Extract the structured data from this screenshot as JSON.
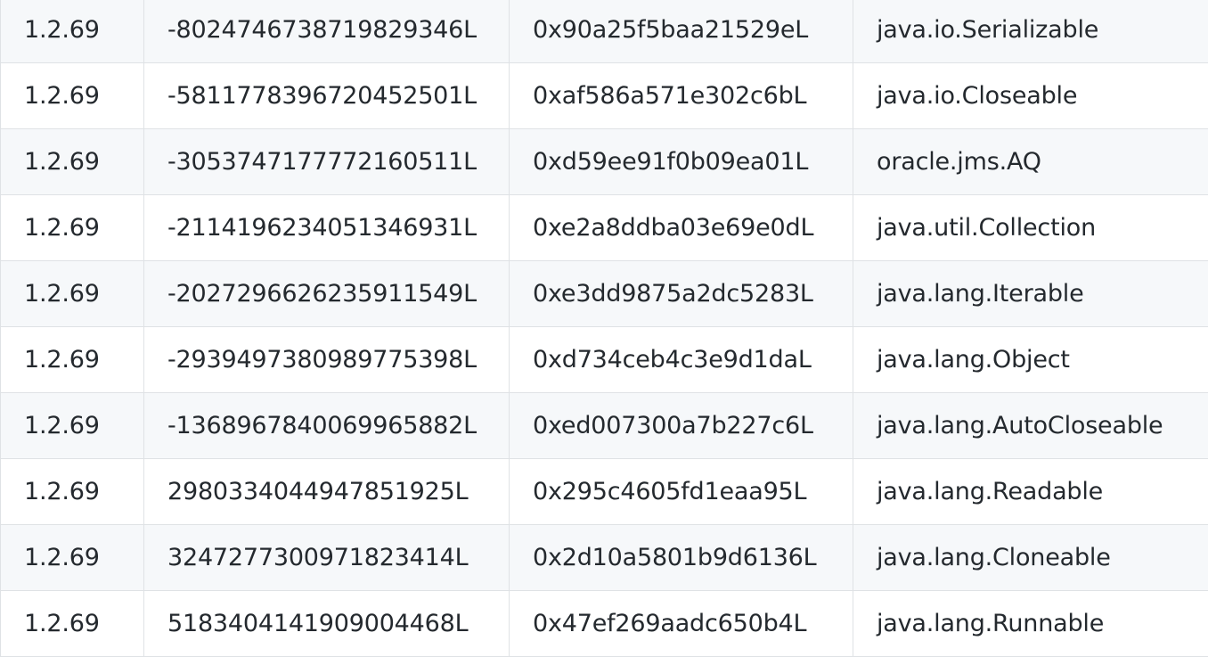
{
  "table": {
    "rows": [
      {
        "version": "1.2.69",
        "hash_decimal": "-8024746738719829346L",
        "hash_hex": "0x90a25f5baa21529eL",
        "class_name": "java.io.Serializable"
      },
      {
        "version": "1.2.69",
        "hash_decimal": "-5811778396720452501L",
        "hash_hex": "0xaf586a571e302c6bL",
        "class_name": "java.io.Closeable"
      },
      {
        "version": "1.2.69",
        "hash_decimal": "-3053747177772160511L",
        "hash_hex": "0xd59ee91f0b09ea01L",
        "class_name": "oracle.jms.AQ"
      },
      {
        "version": "1.2.69",
        "hash_decimal": "-2114196234051346931L",
        "hash_hex": "0xe2a8ddba03e69e0dL",
        "class_name": "java.util.Collection"
      },
      {
        "version": "1.2.69",
        "hash_decimal": "-2027296626235911549L",
        "hash_hex": "0xe3dd9875a2dc5283L",
        "class_name": "java.lang.Iterable"
      },
      {
        "version": "1.2.69",
        "hash_decimal": "-2939497380989775398L",
        "hash_hex": "0xd734ceb4c3e9d1daL",
        "class_name": "java.lang.Object"
      },
      {
        "version": "1.2.69",
        "hash_decimal": "-1368967840069965882L",
        "hash_hex": "0xed007300a7b227c6L",
        "class_name": "java.lang.AutoCloseable"
      },
      {
        "version": "1.2.69",
        "hash_decimal": "2980334044947851925L",
        "hash_hex": "0x295c4605fd1eaa95L",
        "class_name": "java.lang.Readable"
      },
      {
        "version": "1.2.69",
        "hash_decimal": "3247277300971823414L",
        "hash_hex": "0x2d10a5801b9d6136L",
        "class_name": "java.lang.Cloneable"
      },
      {
        "version": "1.2.69",
        "hash_decimal": "5183404141909004468L",
        "hash_hex": "0x47ef269aadc650b4L",
        "class_name": "java.lang.Runnable"
      }
    ]
  },
  "colors": {
    "row_striped": "#f6f8fa",
    "row_plain": "#ffffff",
    "border": "#dfe2e5",
    "text": "#24292e"
  }
}
